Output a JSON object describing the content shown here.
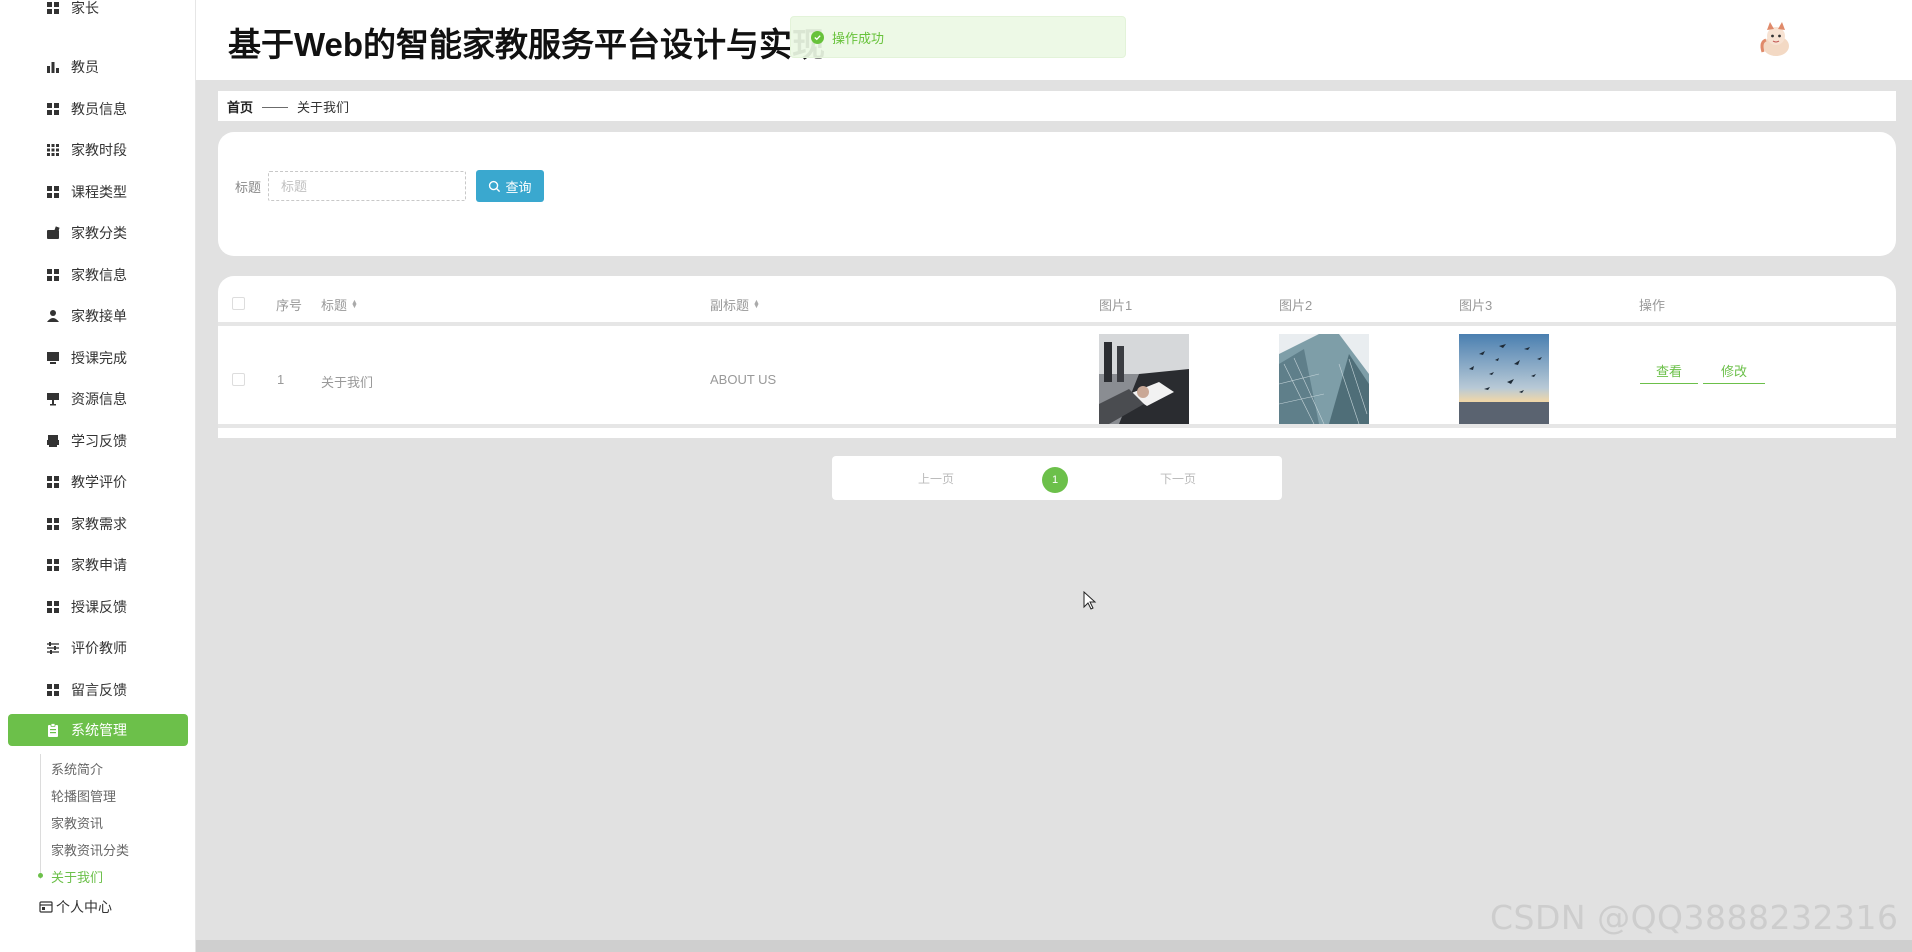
{
  "app": {
    "title": "基于Web的智能家教服务平台设计与实现",
    "toast": "操作成功"
  },
  "sidebar": {
    "items": [
      {
        "label": "家长",
        "icon": "grid-icon"
      },
      {
        "label": "教员",
        "icon": "bar-chart-icon"
      },
      {
        "label": "教员信息",
        "icon": "grid-icon"
      },
      {
        "label": "家教时段",
        "icon": "grid-dots-icon"
      },
      {
        "label": "课程类型",
        "icon": "grid-icon"
      },
      {
        "label": "家教分类",
        "icon": "briefcase-icon"
      },
      {
        "label": "家教信息",
        "icon": "grid-icon"
      },
      {
        "label": "家教接单",
        "icon": "user-icon"
      },
      {
        "label": "授课完成",
        "icon": "monitor-icon"
      },
      {
        "label": "资源信息",
        "icon": "stand-icon"
      },
      {
        "label": "学习反馈",
        "icon": "printer-icon"
      },
      {
        "label": "教学评价",
        "icon": "grid-icon"
      },
      {
        "label": "家教需求",
        "icon": "grid-icon"
      },
      {
        "label": "家教申请",
        "icon": "grid-icon"
      },
      {
        "label": "授课反馈",
        "icon": "grid-icon"
      },
      {
        "label": "评价教师",
        "icon": "sliders-icon"
      },
      {
        "label": "留言反馈",
        "icon": "grid-icon"
      }
    ],
    "active": {
      "label": "系统管理",
      "icon": "clipboard-icon"
    },
    "submenu": [
      "系统简介",
      "轮播图管理",
      "家教资讯",
      "家教资讯分类",
      "关于我们"
    ],
    "submenu_current": "关于我们",
    "personal": "个人中心"
  },
  "breadcrumb": {
    "home": "首页",
    "separator": "——",
    "current": "关于我们"
  },
  "search": {
    "label": "标题",
    "placeholder": "标题",
    "button": "查询"
  },
  "table": {
    "headers": {
      "index": "序号",
      "title": "标题",
      "subtitle": "副标题",
      "img1": "图片1",
      "img2": "图片2",
      "img3": "图片3",
      "actions": "操作"
    },
    "rows": [
      {
        "index": "1",
        "title": "关于我们",
        "subtitle": "ABOUT US",
        "view": "查看",
        "edit": "修改"
      }
    ]
  },
  "pagination": {
    "prev": "上一页",
    "current": "1",
    "next": "下一页"
  },
  "watermark": "CSDN @QQ3888232316",
  "colors": {
    "accent": "#6cc04a",
    "search_button": "#3aa8cf",
    "background": "#e1e1e1"
  }
}
